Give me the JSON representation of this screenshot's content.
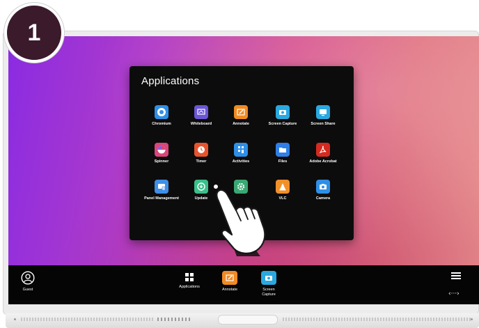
{
  "step_badge": "1",
  "applications_panel": {
    "title": "Applications",
    "apps": [
      {
        "label": "Chromium",
        "icon": "chromium-icon",
        "color": "#2f8fe6"
      },
      {
        "label": "Whiteboard",
        "icon": "whiteboard-icon",
        "color": "#6b56d6"
      },
      {
        "label": "Annotate",
        "icon": "annotate-icon",
        "color": "#f08a24"
      },
      {
        "label": "Screen Capture",
        "icon": "screen-capture-icon",
        "color": "#2aa8e0"
      },
      {
        "label": "Screen Share",
        "icon": "screen-share-icon",
        "color": "#2aa8e0"
      },
      {
        "label": "Spinner",
        "icon": "spinner-icon",
        "color": "#d9467a"
      },
      {
        "label": "Timer",
        "icon": "timer-icon",
        "color": "#e8542e"
      },
      {
        "label": "Activities",
        "icon": "activities-icon",
        "color": "#2f8fe6"
      },
      {
        "label": "Files",
        "icon": "files-icon",
        "color": "#2f7fe6"
      },
      {
        "label": "Adobe Acrobat",
        "icon": "adobe-acrobat-icon",
        "color": "#d42a20"
      },
      {
        "label": "Panel Management",
        "icon": "panel-management-icon",
        "color": "#3f8fe8"
      },
      {
        "label": "Update",
        "icon": "update-icon",
        "color": "#3bbf8a"
      },
      {
        "label": "",
        "icon": "settings-icon",
        "color": "#3aa873"
      },
      {
        "label": "VLC",
        "icon": "vlc-icon",
        "color": "#f0902a"
      },
      {
        "label": "Camera",
        "icon": "camera-icon",
        "color": "#2f8fe6"
      }
    ]
  },
  "taskbar": {
    "guest_label": "Guest",
    "items": [
      {
        "label": "Applications",
        "icon": "applications-grid-icon"
      },
      {
        "label": "Annotate",
        "icon": "annotate-icon",
        "color": "#f08a24"
      },
      {
        "label": "Screen Capture",
        "icon": "screen-capture-icon",
        "color": "#2aa8e0"
      }
    ],
    "menu_icon": "hamburger-menu-icon",
    "nav_label": "‹···›"
  },
  "colors": {
    "taskbar_bg": "#050505",
    "panel_bg": "#0c0c0c",
    "badge_bg": "#3b1a2c"
  }
}
